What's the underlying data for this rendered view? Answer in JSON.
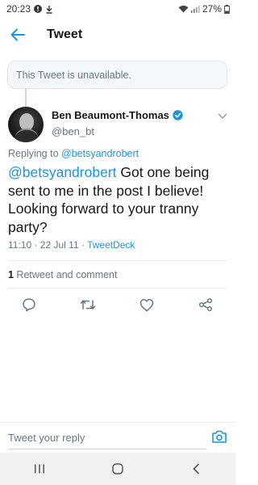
{
  "status_bar": {
    "time": "20:23",
    "battery": "27%"
  },
  "header": {
    "title": "Tweet"
  },
  "unavailable_notice": "This Tweet is unavailable.",
  "tweet": {
    "author_name": "Ben Beaumont-Thomas",
    "author_handle": "@ben_bt",
    "replying_prefix": "Replying to",
    "replying_to": "@betsyandrobert",
    "text_mention": "@betsyandrobert",
    "text_body": " Got one being sent to me in the post I believe! Looking forward to your tranny party?",
    "timestamp": "11:10 · 22 Jul 11 · ",
    "source": "TweetDeck"
  },
  "stats": {
    "count": "1",
    "label": " Retweet and comment"
  },
  "reply_bar": {
    "placeholder": "Tweet your reply"
  },
  "colors": {
    "accent": "#1b95e0",
    "secondary_text": "#657786"
  },
  "icons": {
    "back": "arrow-left-icon",
    "verified": "verified-badge-icon",
    "more": "chevron-down-icon",
    "reply": "comment-icon",
    "retweet": "retweet-icon",
    "like": "heart-icon",
    "share": "share-icon",
    "camera": "camera-icon"
  }
}
